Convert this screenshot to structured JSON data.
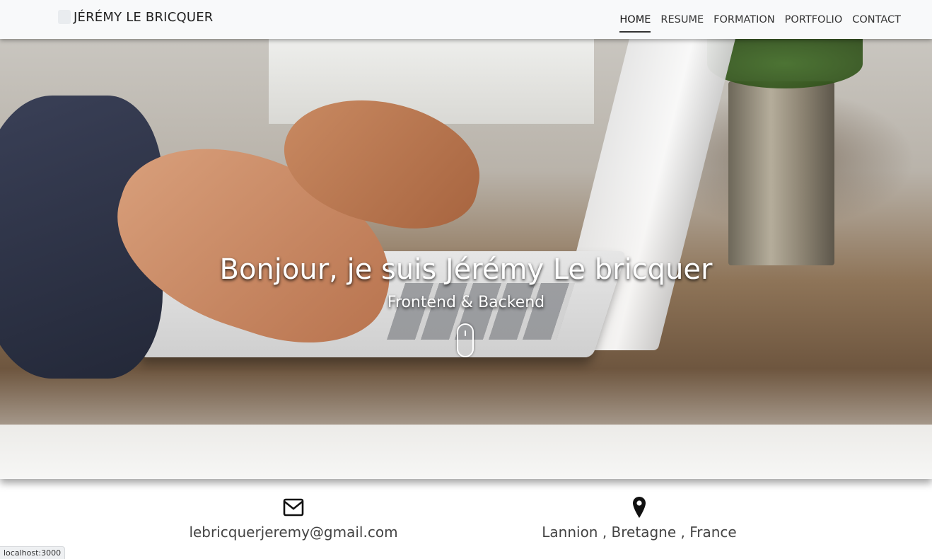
{
  "navbar": {
    "brand": "JÉRÉMY LE BRICQUER",
    "links": [
      {
        "label": "HOME",
        "active": true
      },
      {
        "label": "RESUME",
        "active": false
      },
      {
        "label": "FORMATION",
        "active": false
      },
      {
        "label": "PORTFOLIO",
        "active": false
      },
      {
        "label": "CONTACT",
        "active": false
      }
    ]
  },
  "hero": {
    "title": "Bonjour, je suis Jérémy Le bricquer",
    "subtitle": "Frontend & Backend",
    "scroll_icon": "mouse-icon"
  },
  "contact": {
    "email": {
      "icon": "envelope-icon",
      "text": "lebricquerjeremy@gmail.com"
    },
    "location": {
      "icon": "map-pin-icon",
      "text": "Lannion , Bretagne , France"
    }
  },
  "status_bar": {
    "text": "localhost:3000"
  }
}
